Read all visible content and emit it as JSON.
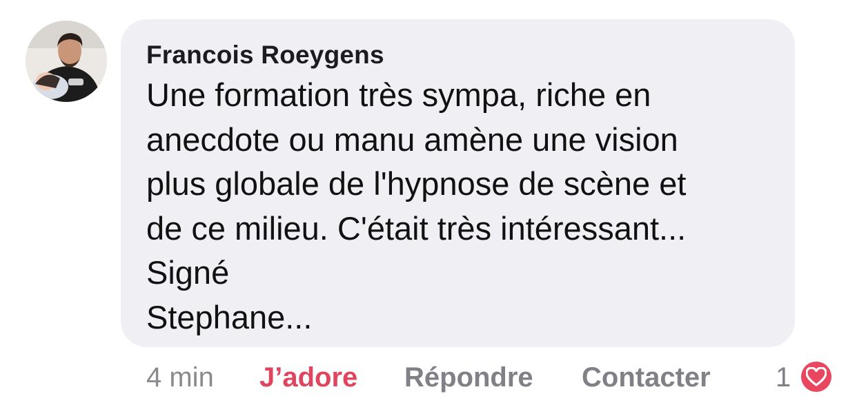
{
  "comment": {
    "author": "Francois Roeygens",
    "text": "Une formation très sympa, riche en\nanecdote ou manu amène une vision\nplus globale de l'hypnose de scène et\nde ce milieu. C'était très intéressant...\nSigné\nStephane...",
    "avatar": "profile-photo"
  },
  "actions": {
    "time": "4 min",
    "love_label": "J’adore",
    "reply_label": "Répondre",
    "contact_label": "Contacter",
    "reaction_count": "1",
    "reaction_icon": "heart-icon"
  },
  "colors": {
    "bubble_bg": "#f0f0f4",
    "love_active": "#e0455f",
    "muted": "#808086",
    "heart_badge": "#e8475f"
  }
}
